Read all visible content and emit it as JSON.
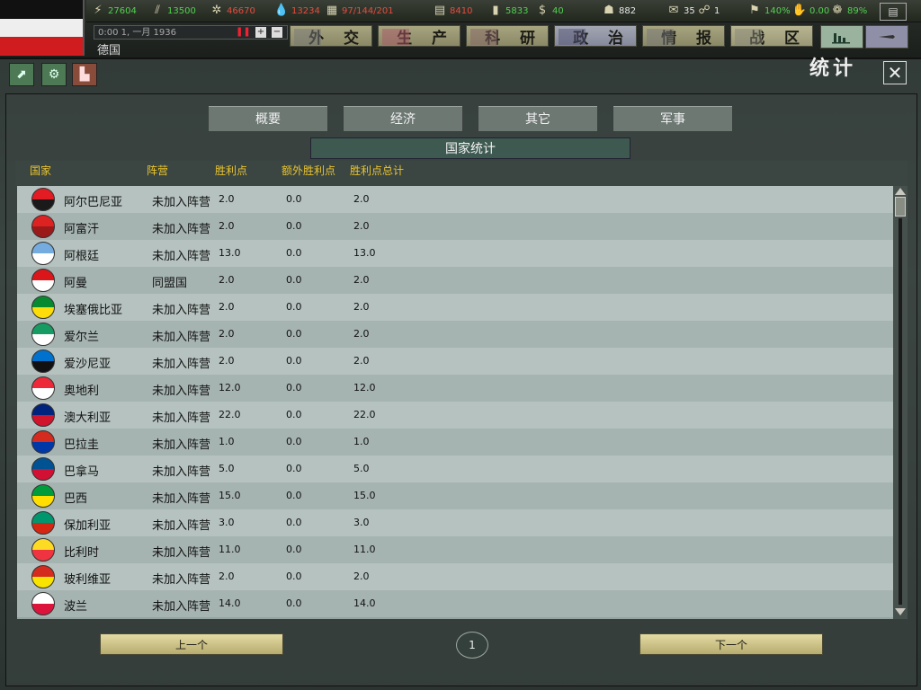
{
  "topbar": {
    "resources": [
      {
        "icon": "energy-icon",
        "glyph": "⚡",
        "value": "27604",
        "color": "#4fd24f"
      },
      {
        "icon": "metal-icon",
        "glyph": "⫽",
        "value": "13500",
        "color": "#4fd24f"
      },
      {
        "icon": "rare-materials-icon",
        "glyph": "✲",
        "value": "46670",
        "color": "#e84b3c"
      },
      {
        "icon": "oil-icon",
        "glyph": "💧",
        "value": "13234",
        "color": "#e84b3c"
      },
      {
        "icon": "industry-icon",
        "glyph": "▦",
        "value": "97/144/201",
        "color": "#e84b3c"
      },
      {
        "icon": "supplies-icon",
        "glyph": "▤",
        "value": "8410",
        "color": "#e84b3c"
      },
      {
        "icon": "fuel-icon",
        "glyph": "▮",
        "value": "5833",
        "color": "#4fd24f"
      },
      {
        "icon": "money-icon",
        "glyph": "$",
        "value": "40",
        "color": "#4fd24f"
      },
      {
        "icon": "manpower-icon",
        "glyph": "☗",
        "value": "882",
        "color": "#e8e8e8"
      },
      {
        "icon": "diplomacy-icon",
        "glyph": "✉",
        "value": "35",
        "color": "#e8e8e8"
      },
      {
        "icon": "spies-icon",
        "glyph": "☍",
        "value": "1",
        "color": "#e8e8e8"
      },
      {
        "icon": "dissent-icon",
        "glyph": "⚑",
        "value": "140%",
        "color": "#4fd24f"
      },
      {
        "icon": "unity-icon",
        "glyph": "✋",
        "value": "0.00",
        "color": "#4fd24f"
      },
      {
        "icon": "leadership-icon",
        "glyph": "❁",
        "value": "89%",
        "color": "#4fd24f"
      }
    ],
    "date": "0:00 1, 一月 1936",
    "country": "德国",
    "nav_tabs": [
      "外 交",
      "生 产",
      "科 研",
      "政 治",
      "情 报",
      "战 区"
    ]
  },
  "screen": {
    "title": "统计",
    "subtabs": [
      "概要",
      "经济",
      "其它",
      "军事"
    ],
    "table_title": "国家统计",
    "columns": [
      "国家",
      "阵营",
      "胜利点",
      "额外胜利点",
      "胜利点总计"
    ],
    "rows": [
      {
        "name": "阿尔巴尼亚",
        "faction": "未加入阵营",
        "vp": "2.0",
        "extra": "0.0",
        "total": "2.0",
        "colors": [
          "#e31b23",
          "#1a1a1a"
        ]
      },
      {
        "name": "阿富汗",
        "faction": "未加入阵营",
        "vp": "2.0",
        "extra": "0.0",
        "total": "2.0",
        "colors": [
          "#d22",
          "#9a1a1a"
        ]
      },
      {
        "name": "阿根廷",
        "faction": "未加入阵营",
        "vp": "13.0",
        "extra": "0.0",
        "total": "13.0",
        "colors": [
          "#74acdf",
          "#ffffff"
        ]
      },
      {
        "name": "阿曼",
        "faction": "同盟国",
        "vp": "2.0",
        "extra": "0.0",
        "total": "2.0",
        "colors": [
          "#db161b",
          "#ffffff"
        ]
      },
      {
        "name": "埃塞俄比亚",
        "faction": "未加入阵营",
        "vp": "2.0",
        "extra": "0.0",
        "total": "2.0",
        "colors": [
          "#078930",
          "#fcdd09"
        ]
      },
      {
        "name": "爱尔兰",
        "faction": "未加入阵营",
        "vp": "2.0",
        "extra": "0.0",
        "total": "2.0",
        "colors": [
          "#169b62",
          "#ffffff"
        ]
      },
      {
        "name": "爱沙尼亚",
        "faction": "未加入阵营",
        "vp": "2.0",
        "extra": "0.0",
        "total": "2.0",
        "colors": [
          "#0072ce",
          "#111111"
        ]
      },
      {
        "name": "奥地利",
        "faction": "未加入阵营",
        "vp": "12.0",
        "extra": "0.0",
        "total": "12.0",
        "colors": [
          "#ed2939",
          "#ffffff"
        ]
      },
      {
        "name": "澳大利亚",
        "faction": "未加入阵营",
        "vp": "22.0",
        "extra": "0.0",
        "total": "22.0",
        "colors": [
          "#00247d",
          "#cf142b"
        ]
      },
      {
        "name": "巴拉圭",
        "faction": "未加入阵营",
        "vp": "1.0",
        "extra": "0.0",
        "total": "1.0",
        "colors": [
          "#d52b1e",
          "#0038a8"
        ]
      },
      {
        "name": "巴拿马",
        "faction": "未加入阵营",
        "vp": "5.0",
        "extra": "0.0",
        "total": "5.0",
        "colors": [
          "#005293",
          "#d21034"
        ]
      },
      {
        "name": "巴西",
        "faction": "未加入阵营",
        "vp": "15.0",
        "extra": "0.0",
        "total": "15.0",
        "colors": [
          "#009c3b",
          "#ffdf00"
        ]
      },
      {
        "name": "保加利亚",
        "faction": "未加入阵营",
        "vp": "3.0",
        "extra": "0.0",
        "total": "3.0",
        "colors": [
          "#00966e",
          "#d62612"
        ]
      },
      {
        "name": "比利时",
        "faction": "未加入阵营",
        "vp": "11.0",
        "extra": "0.0",
        "total": "11.0",
        "colors": [
          "#fdda24",
          "#ef3340"
        ]
      },
      {
        "name": "玻利维亚",
        "faction": "未加入阵营",
        "vp": "2.0",
        "extra": "0.0",
        "total": "2.0",
        "colors": [
          "#d52b1e",
          "#f9e300"
        ]
      },
      {
        "name": "波兰",
        "faction": "未加入阵营",
        "vp": "14.0",
        "extra": "0.0",
        "total": "14.0",
        "colors": [
          "#ffffff",
          "#dc143c"
        ]
      }
    ],
    "prev_label": "上一个",
    "next_label": "下一个",
    "page": "1"
  }
}
